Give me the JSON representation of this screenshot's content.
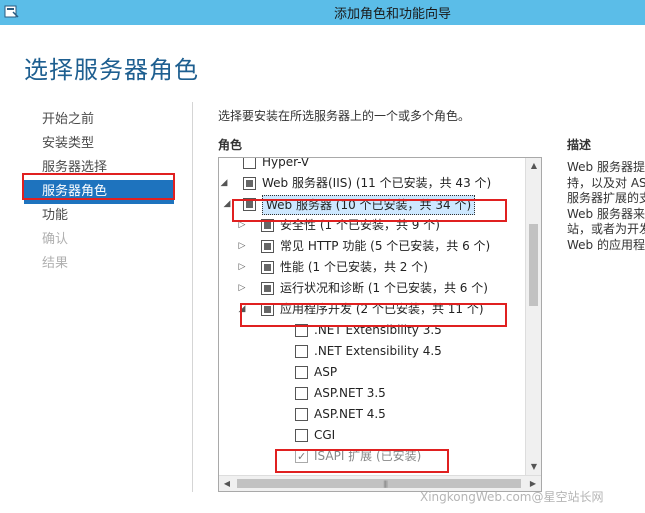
{
  "window": {
    "title": "添加角色和功能向导"
  },
  "page_title": "选择服务器角色",
  "nav": [
    {
      "label": "开始之前",
      "state": "normal"
    },
    {
      "label": "安装类型",
      "state": "normal"
    },
    {
      "label": "服务器选择",
      "state": "normal"
    },
    {
      "label": "服务器角色",
      "state": "active"
    },
    {
      "label": "功能",
      "state": "normal"
    },
    {
      "label": "确认",
      "state": "disabled"
    },
    {
      "label": "结果",
      "state": "disabled"
    }
  ],
  "instruction": "选择要安装在所选服务器上的一个或多个角色。",
  "roles_header": "角色",
  "desc_header": "描述",
  "description": [
    "Web 服务器提",
    "持，以及对 AS",
    "服务器扩展的支",
    "Web 服务器来",
    "站，或者为开发",
    "Web 的应用程"
  ],
  "tree": [
    {
      "label": "Hyper-V",
      "level": 0,
      "expander": "",
      "check": "unchecked"
    },
    {
      "label": "Web 服务器(IIS) (11 个已安装，共 43 个)",
      "level": 0,
      "expander": "open",
      "check": "partial"
    },
    {
      "label": "Web 服务器 (10 个已安装，共 34 个)",
      "level": 1,
      "expander": "open",
      "check": "partial",
      "selected": true
    },
    {
      "label": "安全性 (1 个已安装，共 9 个)",
      "level": 2,
      "expander": "closed",
      "check": "partial"
    },
    {
      "label": "常见 HTTP 功能 (5 个已安装，共 6 个)",
      "level": 2,
      "expander": "closed",
      "check": "partial"
    },
    {
      "label": "性能 (1 个已安装，共 2 个)",
      "level": 2,
      "expander": "closed",
      "check": "partial"
    },
    {
      "label": "运行状况和诊断 (1 个已安装，共 6 个)",
      "level": 2,
      "expander": "closed",
      "check": "partial"
    },
    {
      "label": "应用程序开发 (2 个已安装，共 11 个)",
      "level": 2,
      "expander": "open",
      "check": "partial"
    },
    {
      "label": ".NET Extensibility 3.5",
      "level": 3,
      "expander": "",
      "check": "unchecked"
    },
    {
      "label": ".NET Extensibility 4.5",
      "level": 3,
      "expander": "",
      "check": "unchecked"
    },
    {
      "label": "ASP",
      "level": 3,
      "expander": "",
      "check": "unchecked"
    },
    {
      "label": "ASP.NET 3.5",
      "level": 3,
      "expander": "",
      "check": "unchecked"
    },
    {
      "label": "ASP.NET 4.5",
      "level": 3,
      "expander": "",
      "check": "unchecked"
    },
    {
      "label": "CGI",
      "level": 3,
      "expander": "",
      "check": "unchecked"
    },
    {
      "label": "ISAPI 扩展 (已安装)",
      "level": 3,
      "expander": "",
      "check": "checked",
      "dim": true
    }
  ],
  "watermark": "XingkongWeb.com@星空站长网",
  "colors": {
    "titlebar": "#5bbde8",
    "nav_active": "#1e73be",
    "highlight_box": "#e02020",
    "page_title": "#1e5f90"
  }
}
